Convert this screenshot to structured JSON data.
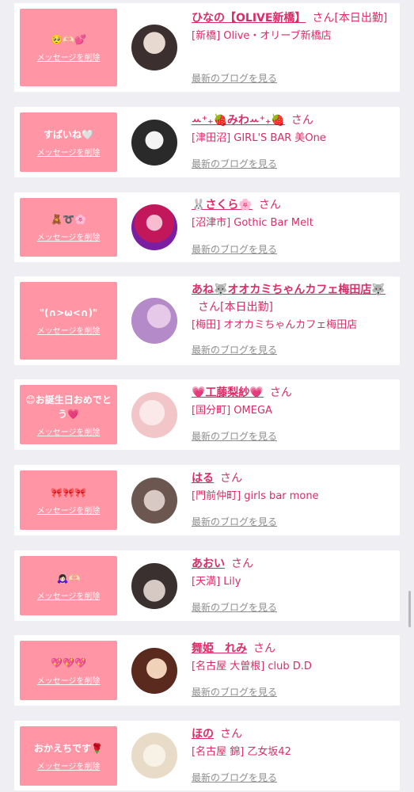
{
  "cards": [
    {
      "message": "🥺🫶🏻💕",
      "delete_label": "メッセージを削除",
      "name": "ひなの【OLIVE新橋】",
      "suffix": "さん[本日出勤]",
      "shop": "[新橋] Olive・オリーブ新橋店",
      "blog_label": "最新のブログを見る",
      "avatar_colors": [
        "#3b2f2f",
        "#e8d9d0"
      ]
    },
    {
      "message": "すばいね🤍",
      "delete_label": "メッセージを削除",
      "name": "ꕀ⁺₊🍓みわꕀ⁺₊🍓",
      "suffix": "さん",
      "shop": "[津田沼] GIRL'S BAR 美One",
      "blog_label": "最新のブログを見る",
      "avatar_colors": [
        "#2a2a2a",
        "#f4f4f4"
      ]
    },
    {
      "message": "🧸➰🌸",
      "delete_label": "メッセージを削除",
      "name": "🐰さくら🌸",
      "suffix": "さん",
      "shop": "[沼津市] Gothic Bar Melt",
      "blog_label": "最新のブログを見る",
      "avatar_colors": [
        "#c2185b",
        "#7b1fa2"
      ]
    },
    {
      "message": "\"(∩>ω<∩)\"",
      "delete_label": "メッセージを削除",
      "name": "あね🐺オオカミちゃんカフェ梅田店🐺",
      "suffix": "さん[本日出勤]",
      "shop": "[梅田] オオカミちゃんカフェ梅田店",
      "blog_label": "最新のブログを見る",
      "avatar_colors": [
        "#b48ac8",
        "#e6c9e8"
      ]
    },
    {
      "message": "😊お誕生日おめでとう💗",
      "delete_label": "メッセージを削除",
      "name": "💗工藤梨紗💗",
      "suffix": "さん",
      "shop": "[国分町] OMEGA",
      "blog_label": "最新のブログを見る",
      "avatar_colors": [
        "#f2c5c9",
        "#fbe9ea"
      ]
    },
    {
      "message": "🎀🎀🎀",
      "delete_label": "メッセージを削除",
      "name": "はる",
      "suffix": "さん",
      "shop": "[門前仲町] girls bar mone",
      "blog_label": "最新のブログを見る",
      "avatar_colors": [
        "#6b5750",
        "#d8c9c4"
      ]
    },
    {
      "message": "🙇🏻‍♀️🫶🏻",
      "delete_label": "メッセージを削除",
      "name": "あおい",
      "suffix": "さん",
      "shop": "[天満] Lily",
      "blog_label": "最新のブログを見る",
      "avatar_colors": [
        "#3a3030",
        "#d6c8c2"
      ]
    },
    {
      "message": "💖💖💖",
      "delete_label": "メッセージを削除",
      "name": "舞姫　れみ",
      "suffix": "さん",
      "shop": "[名古屋 大曽根] club D.D",
      "blog_label": "最新のブログを見る",
      "avatar_colors": [
        "#5a2a1e",
        "#f0d2b8"
      ]
    },
    {
      "message": "おかえちです🌹",
      "delete_label": "メッセージを削除",
      "name": "ほの",
      "suffix": "さん",
      "shop": "[名古屋 錦] 乙女坂42",
      "blog_label": "最新のブログを見る",
      "avatar_colors": [
        "#e8dcc8",
        "#f8f1e6"
      ]
    }
  ]
}
